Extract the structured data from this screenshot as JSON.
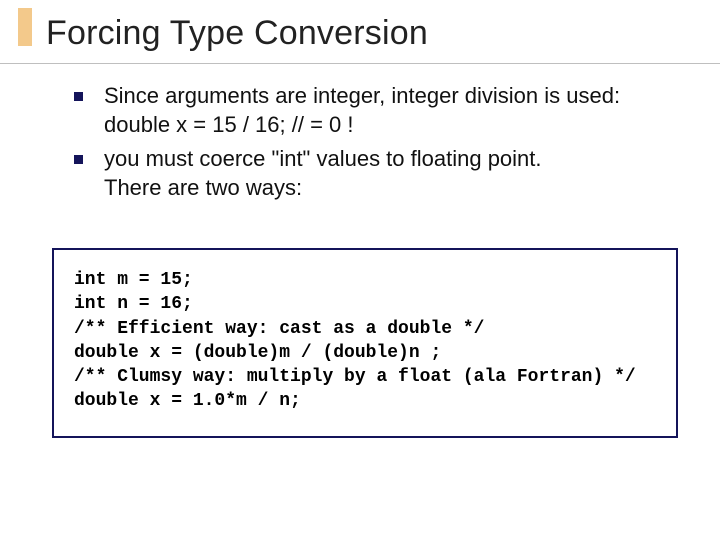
{
  "title": "Forcing Type Conversion",
  "bullets": [
    {
      "text": "Since arguments are integer, integer division is used:",
      "cont": "double x =  15 / 16;  // = 0 !"
    },
    {
      "text": "you must coerce \"int\" values to floating point.",
      "cont": "There are two ways:"
    }
  ],
  "code": {
    "block1": "int m = 15;\nint n = 16;\n/** Efficient way: cast as a double */\ndouble x = (double)m / (double)n ;",
    "block2": "/** Clumsy way: multiply by a float (ala Fortran) */\ndouble x = 1.0*m / n;"
  }
}
